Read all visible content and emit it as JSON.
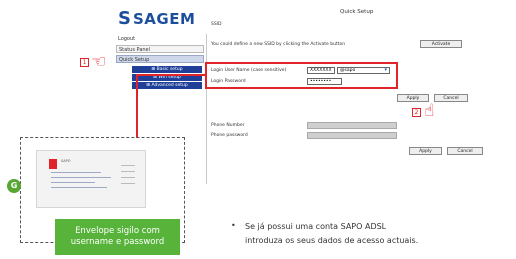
{
  "brand": {
    "logo_text": "SAGEM",
    "brand_color": "#1d4e9e"
  },
  "sidebar": {
    "items": [
      {
        "label": "Logout"
      },
      {
        "label": "Status Panel"
      },
      {
        "label": "Quick Setup"
      }
    ],
    "sub_items": [
      {
        "label": "⊞ Basic setup"
      },
      {
        "label": "⊞ Wifi setup"
      },
      {
        "label": "⊞ Advanced setup"
      }
    ]
  },
  "main": {
    "title": "Quick Setup",
    "row1_label": "SSID",
    "row2_text": "You could define a new SSID by clicking the Activate button",
    "activate_label": "Activate",
    "username_label": "Login User Name (case sensitive)",
    "username_value": "XXXXXXX",
    "domain_value": "@sapo",
    "password_label": "Login Password",
    "password_value": "••••••••",
    "apply_label": "Apply",
    "cancel_label": "Cancel",
    "phone_number_label": "Phone Number",
    "phone_password_label": "Phone password",
    "apply2_label": "Apply",
    "cancel2_label": "Cancel"
  },
  "steps": {
    "step1": "1",
    "step2": "2"
  },
  "envelope": {
    "badge": "G",
    "card_title": "SAPO",
    "note_line1": "Envelope sigilo com",
    "note_line2": "username e password"
  },
  "notes": {
    "bullet": "•",
    "line1": "Se já possui uma conta SAPO ADSL",
    "line2": "introduza os seus dados de acesso actuais."
  },
  "colors": {
    "highlight": "#e2232a",
    "accent_green": "#57b33a",
    "nav_blue": "#1f3f99"
  }
}
